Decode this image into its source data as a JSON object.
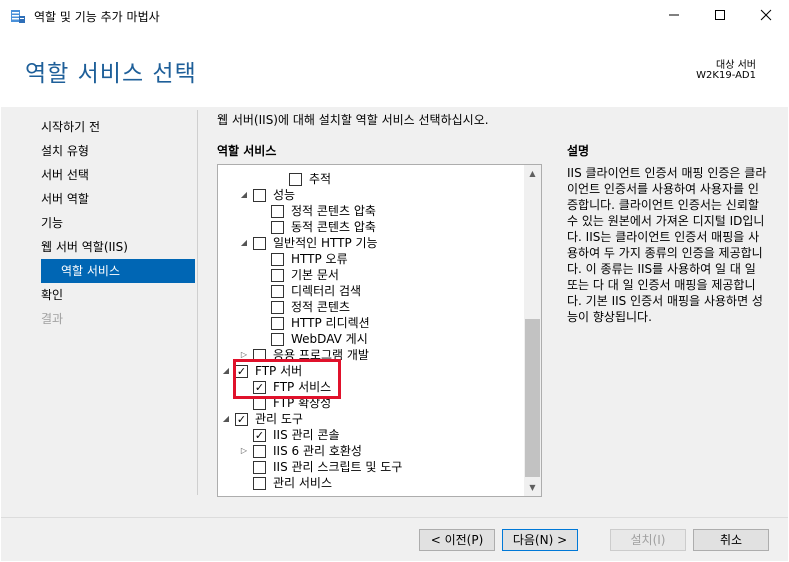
{
  "window": {
    "title": "역할 및 기능 추가 마법사",
    "minimize_icon": "minimize-icon",
    "maximize_icon": "maximize-icon",
    "close_icon": "close-icon"
  },
  "header": {
    "page_title": "역할 서비스 선택",
    "destination_label": "대상 서버",
    "destination_server": "W2K19-AD1"
  },
  "nav": {
    "items": [
      {
        "label": "시작하기 전",
        "state": "normal"
      },
      {
        "label": "설치 유형",
        "state": "normal"
      },
      {
        "label": "서버 선택",
        "state": "normal"
      },
      {
        "label": "서버 역할",
        "state": "normal"
      },
      {
        "label": "기능",
        "state": "normal"
      },
      {
        "label": "웹 서버 역할(IIS)",
        "state": "normal"
      },
      {
        "label": "역할 서비스",
        "state": "active"
      },
      {
        "label": "확인",
        "state": "normal"
      },
      {
        "label": "결과",
        "state": "disabled"
      }
    ]
  },
  "main": {
    "instruction": "웹 서버(IIS)에 대해 설치할 역할 서비스 선택하십시오.",
    "roles_heading": "역할 서비스",
    "description_heading": "설명",
    "description": "IIS 클라이언트 인증서 매핑 인증은 클라이언트 인증서를 사용하여 사용자를 인증합니다. 클라이언트 인증서는 신뢰할 수 있는 원본에서 가져온 디지털 ID입니다. IIS는 클라이언트 인증서 매핑을 사용하여 두 가지 종류의 인증을 제공합니다. 이 종류는 IIS를 사용하여 일 대 일 또는 다 대 일 인증서 매핑을 제공합니다. 기본 IIS 인증서 매핑을 사용하면 성능이 향상됩니다."
  },
  "tree": [
    {
      "label": "추적",
      "checked": false,
      "expander": "none"
    },
    {
      "label": "성능",
      "checked": false,
      "expander": "expanded"
    },
    {
      "label": "정적 콘텐츠 압축",
      "checked": false,
      "expander": "none"
    },
    {
      "label": "동적 콘텐츠 압축",
      "checked": false,
      "expander": "none"
    },
    {
      "label": "일반적인 HTTP 기능",
      "checked": false,
      "expander": "expanded"
    },
    {
      "label": "HTTP 오류",
      "checked": false,
      "expander": "none"
    },
    {
      "label": "기본 문서",
      "checked": false,
      "expander": "none"
    },
    {
      "label": "디렉터리 검색",
      "checked": false,
      "expander": "none"
    },
    {
      "label": "정적 콘텐츠",
      "checked": false,
      "expander": "none"
    },
    {
      "label": "HTTP 리디렉션",
      "checked": false,
      "expander": "none"
    },
    {
      "label": "WebDAV 게시",
      "checked": false,
      "expander": "none"
    },
    {
      "label": "응용 프로그램 개발",
      "checked": false,
      "expander": "collapsed"
    },
    {
      "label": "FTP 서버",
      "checked": true,
      "expander": "expanded"
    },
    {
      "label": "FTP 서비스",
      "checked": true,
      "expander": "none"
    },
    {
      "label": "FTP 확장성",
      "checked": false,
      "expander": "none"
    },
    {
      "label": "관리 도구",
      "checked": true,
      "expander": "expanded"
    },
    {
      "label": "IIS 관리 콘솔",
      "checked": true,
      "expander": "none"
    },
    {
      "label": "IIS 6 관리 호환성",
      "checked": false,
      "expander": "collapsed"
    },
    {
      "label": "IIS 관리 스크립트 및 도구",
      "checked": false,
      "expander": "none"
    },
    {
      "label": "관리 서비스",
      "checked": false,
      "expander": "none"
    }
  ],
  "footer": {
    "prev_label": "< 이전(P)",
    "next_label": "다음(N) >",
    "install_label": "설치(I)",
    "cancel_label": "취소"
  }
}
